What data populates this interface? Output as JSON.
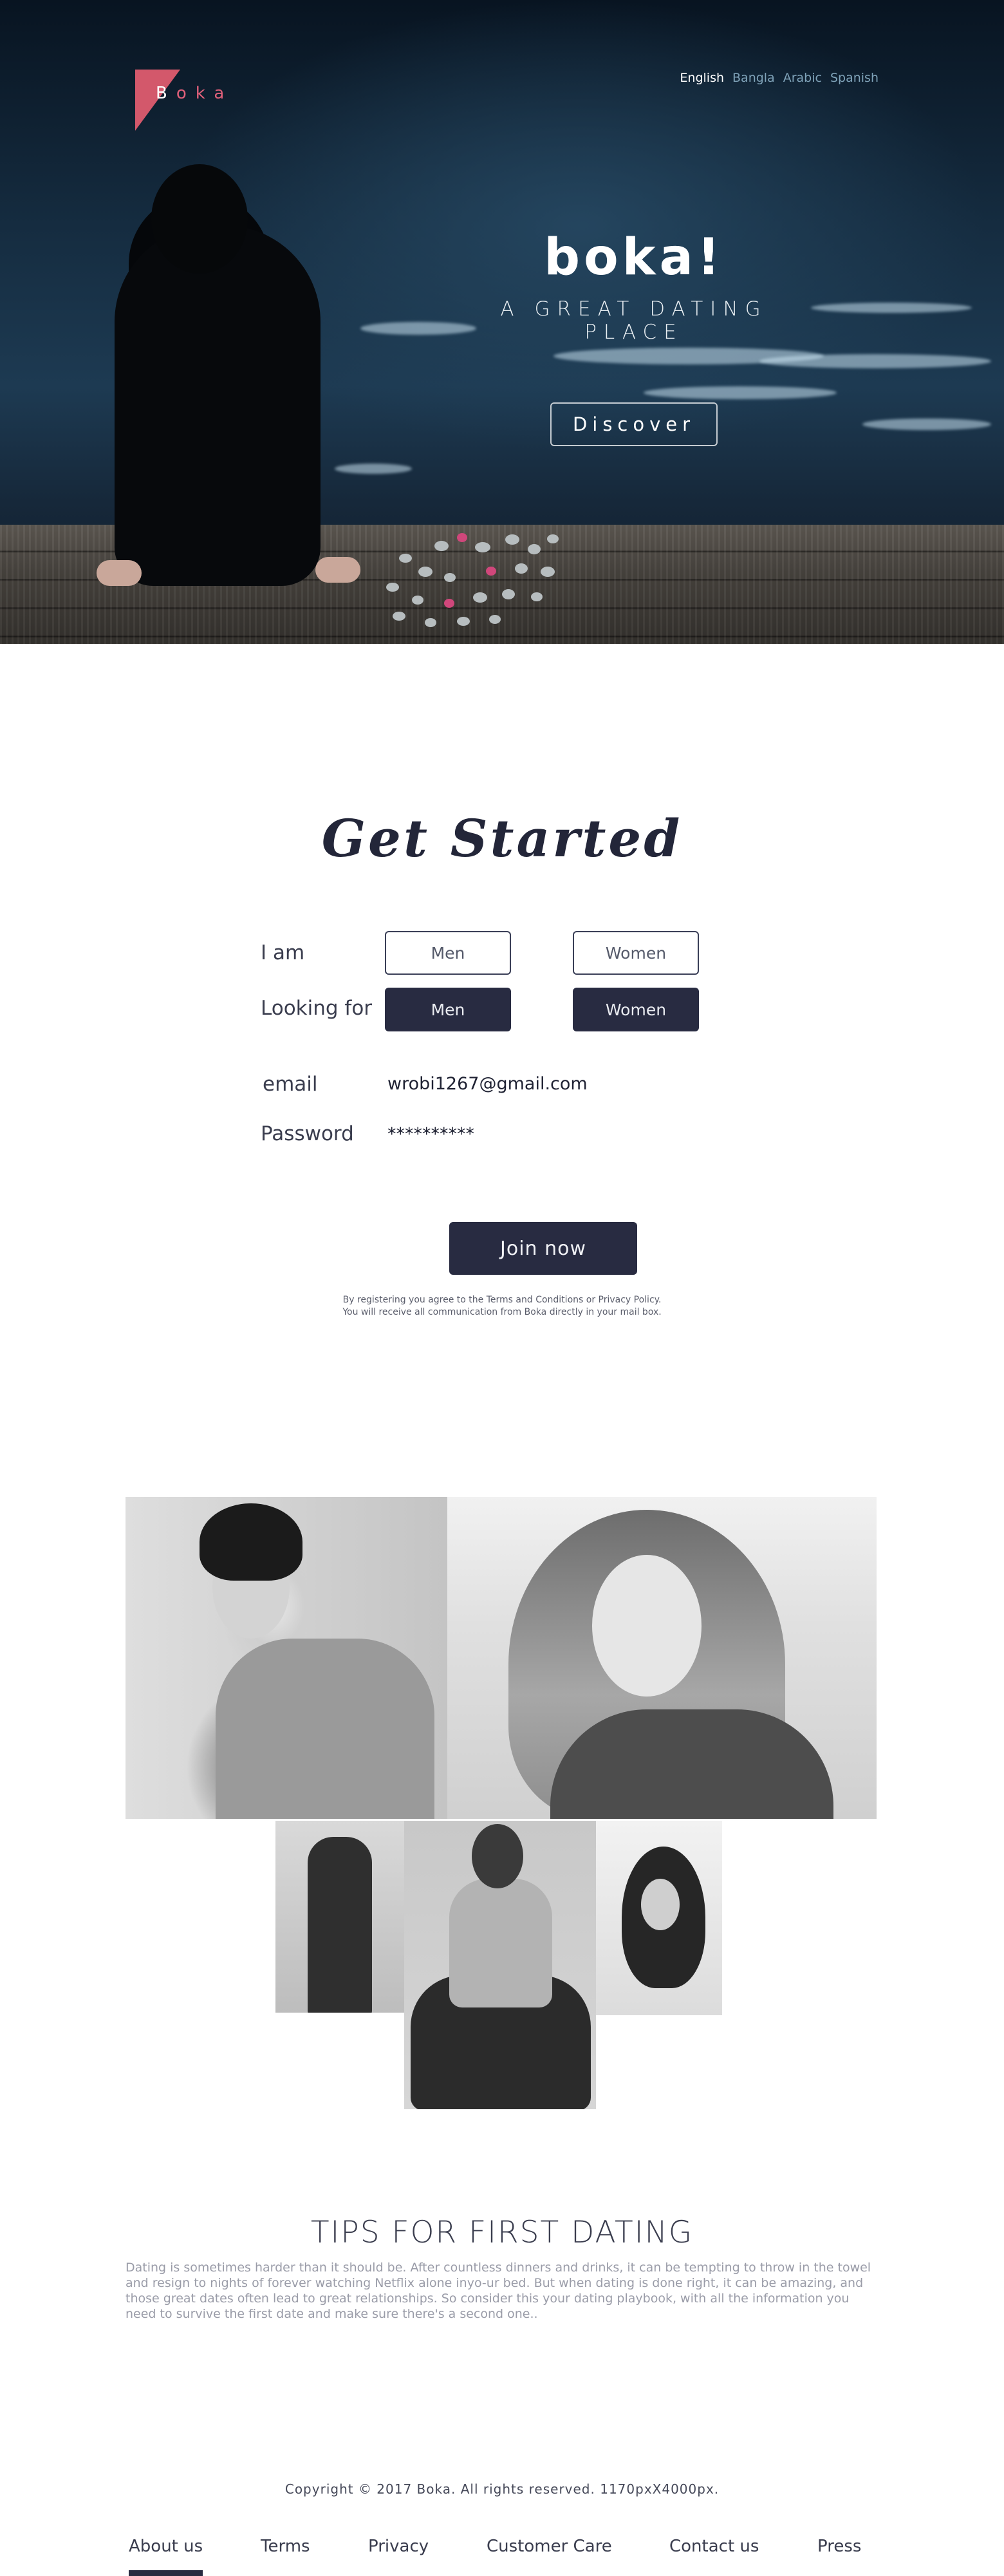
{
  "brand": {
    "logo_first": "B",
    "logo_rest": "oka"
  },
  "languages": [
    {
      "label": "English",
      "active": true
    },
    {
      "label": "Bangla",
      "active": false
    },
    {
      "label": "Arabic",
      "active": false
    },
    {
      "label": "Spanish",
      "active": false
    }
  ],
  "hero": {
    "title": "boka!",
    "subtitle": "A GREAT DATING PLACE",
    "cta": "Discover"
  },
  "signup": {
    "title": "Get Started",
    "i_am_label": "I am",
    "looking_for_label": "Looking for",
    "i_am_options": [
      "Men",
      "Women"
    ],
    "looking_for_options": [
      "Men",
      "Women"
    ],
    "email_label": "email",
    "email_value": "wrobi1267@gmail.com",
    "password_label": "Password",
    "password_value": "**********",
    "join_button": "Join now",
    "terms_line1": "By registering you agree to the Terms and Conditions or Privacy Policy.",
    "terms_line2": "You will receive all communication from Boka directly in your mail box."
  },
  "tips": {
    "title": "TIPS FOR FIRST DATING",
    "body": "Dating is sometimes harder than it should be. After countless dinners and drinks, it can be tempting to throw in the towel and resign to nights of forever watching Netflix alone inyo-ur bed. But when dating is done right, it can be amazing, and those great dates often lead to great relationships. So consider this your dating playbook, with all the information you need to survive the first date and make sure there's a second one.."
  },
  "footer": {
    "copyright": "Copyright © 2017 Boka. All rights reserved. 1170pxX4000px.",
    "nav": [
      "About us",
      "Terms",
      "Privacy",
      "Customer Care",
      "Contact us",
      "Press"
    ],
    "active_nav": "About us"
  }
}
